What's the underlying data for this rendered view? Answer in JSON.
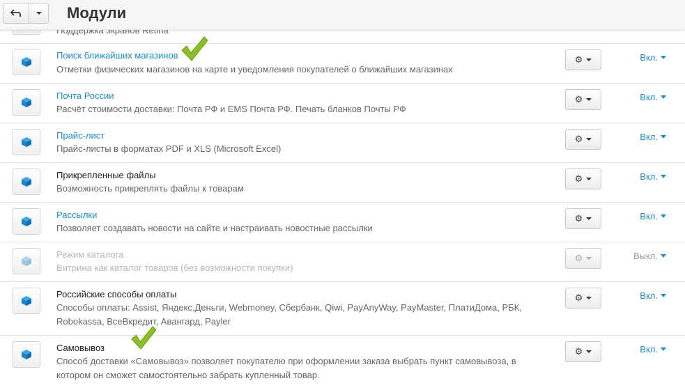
{
  "header": {
    "title": "Модули",
    "back_icon": "arrow-back-icon",
    "dropdown_icon": "caret-down-icon"
  },
  "colors": {
    "link": "#1a8ccf",
    "cube": "#1e8fd4",
    "check": "#8cbf26"
  },
  "modules": [
    {
      "title": "",
      "desc": "Поддержка экранов Retina",
      "link": false,
      "status": "",
      "enabled": true
    },
    {
      "title": "Поиск ближайших магазинов",
      "desc": "Отметки физических магазинов на карте и уведомления покупателей о ближайших магазинах",
      "link": true,
      "status": "Вкл.",
      "enabled": true
    },
    {
      "title": "Почта России",
      "desc": "Расчёт стоимости доставки: Почта РФ и EMS Почта РФ. Печать бланков Почты РФ",
      "link": true,
      "status": "Вкл.",
      "enabled": true
    },
    {
      "title": "Прайс-лист",
      "desc": "Прайс-листы в форматах PDF и XLS (Microsoft Excel)",
      "link": true,
      "status": "Вкл.",
      "enabled": true
    },
    {
      "title": "Прикрепленные файлы",
      "desc": "Возможность прикреплять файлы к товарам",
      "link": false,
      "status": "Вкл.",
      "enabled": true
    },
    {
      "title": "Рассылки",
      "desc": "Позволяет создавать новости на сайте и настраивать новостные рассылки",
      "link": true,
      "status": "Вкл.",
      "enabled": true
    },
    {
      "title": "Режим каталога",
      "desc": "Витрина как каталог товаров (без возможности покупки)",
      "link": false,
      "status": "Выкл.",
      "enabled": false
    },
    {
      "title": "Российские способы оплаты",
      "desc": "Способы оплаты: Assist, Яндекс.Деньги, Webmoney, Сбербанк, Qiwi, PayAnyWay, PayMaster, ПлатиДома, РБК, Robokassa, ВсеВкредит, Авангард, Payler",
      "link": false,
      "status": "Вкл.",
      "enabled": true
    },
    {
      "title": "Самовывоз",
      "desc": "Способ доставки «Самовывоз» позволяет покупателю при оформлении заказа выбрать пункт самовывоза, в котором он сможет самостоятельно забрать купленный товар.",
      "link": false,
      "status": "Вкл.",
      "enabled": true
    }
  ]
}
